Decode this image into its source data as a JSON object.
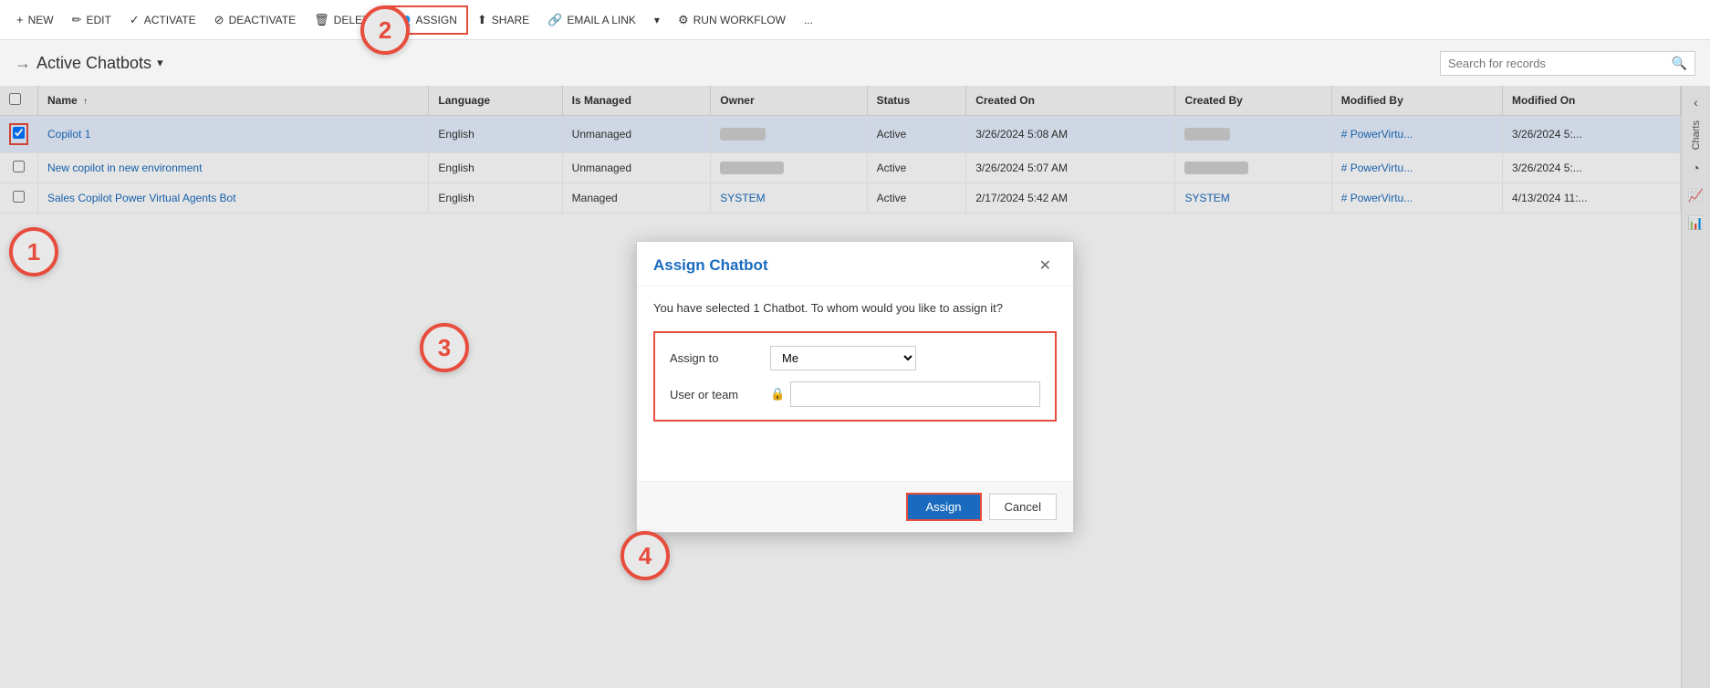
{
  "toolbar": {
    "new_label": "NEW",
    "edit_label": "EDIT",
    "activate_label": "ACTIVATE",
    "deactivate_label": "DEACTIVATE",
    "delete_label": "DELETE",
    "assign_label": "ASSIGN",
    "share_label": "SHARE",
    "email_label": "EMAIL A LINK",
    "workflow_label": "RUN WORKFLOW",
    "more_label": "..."
  },
  "view": {
    "title": "Active Chatbots",
    "search_placeholder": "Search for records"
  },
  "table": {
    "columns": [
      "",
      "Name",
      "Language",
      "Is Managed",
      "Owner",
      "Status",
      "Created On",
      "Created By",
      "Modified By",
      "Modified On"
    ],
    "rows": [
      {
        "id": 1,
        "name": "Copilot 1",
        "language": "English",
        "is_managed": "Unmanaged",
        "owner_blurred": true,
        "status": "Active",
        "created_on": "3/26/2024 5:08 AM",
        "created_by_blurred": true,
        "modified_by": "# PowerVirtu...",
        "modified_on": "3/26/2024 5:...",
        "selected": true
      },
      {
        "id": 2,
        "name": "New copilot in new environment",
        "language": "English",
        "is_managed": "Unmanaged",
        "owner_blurred": true,
        "status": "Active",
        "created_on": "3/26/2024 5:07 AM",
        "created_by_blurred": true,
        "modified_by": "# PowerVirtu...",
        "modified_on": "3/26/2024 5:...",
        "selected": false
      },
      {
        "id": 3,
        "name": "Sales Copilot Power Virtual Agents Bot",
        "language": "English",
        "is_managed": "Managed",
        "owner": "SYSTEM",
        "status": "Active",
        "created_on": "2/17/2024 5:42 AM",
        "created_by": "SYSTEM",
        "modified_by": "# PowerVirtu...",
        "modified_on": "4/13/2024 11:...",
        "selected": false
      }
    ]
  },
  "modal": {
    "title": "Assign Chatbot",
    "description": "You have selected 1 Chatbot. To whom would you like to assign it?",
    "assign_to_label": "Assign to",
    "assign_to_value": "Me",
    "user_or_team_label": "User or team",
    "user_or_team_value": "",
    "assign_button": "Assign",
    "cancel_button": "Cancel"
  },
  "steps": {
    "step1": "1",
    "step2": "2",
    "step3": "3",
    "step4": "4"
  },
  "right_panel": {
    "label": "Charts",
    "icons": [
      "chevron-left",
      "pie-chart",
      "bar-chart",
      "column-chart"
    ]
  }
}
